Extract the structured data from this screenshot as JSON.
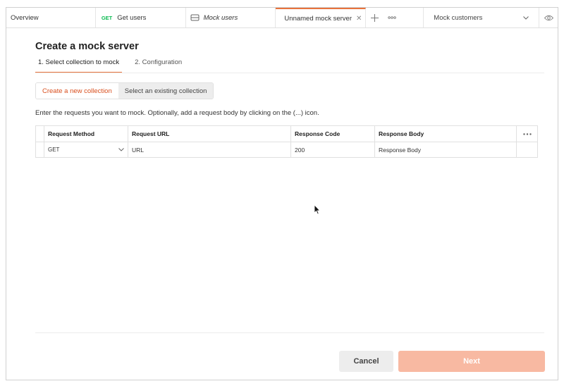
{
  "tabs": [
    {
      "label": "Overview",
      "method": "",
      "icon": ""
    },
    {
      "label": "Get users",
      "method": "GET",
      "icon": ""
    },
    {
      "label": "Mock users",
      "method": "",
      "icon": "mock-server-icon"
    },
    {
      "label": "Unnamed mock server",
      "method": "",
      "icon": "mock-server-icon",
      "active": true
    }
  ],
  "environment": {
    "selected": "Mock customers"
  },
  "page": {
    "title": "Create a mock server",
    "steps": [
      "1.  Select collection to mock",
      "2.  Configuration"
    ],
    "toggle": {
      "new": "Create a new collection",
      "existing": "Select an existing collection"
    },
    "instructions": "Enter the requests you want to mock. Optionally, add a request body by clicking on the (...) icon."
  },
  "table": {
    "headers": [
      "Request Method",
      "Request URL",
      "Response Code",
      "Response Body"
    ],
    "row": {
      "method": "GET",
      "url_placeholder": "URL",
      "code": "200",
      "body_placeholder": "Response Body"
    }
  },
  "buttons": {
    "cancel": "Cancel",
    "next": "Next"
  },
  "colors": {
    "accent": "#e8733c",
    "get": "#0cbb52",
    "next_disabled": "#f8b9a2"
  }
}
